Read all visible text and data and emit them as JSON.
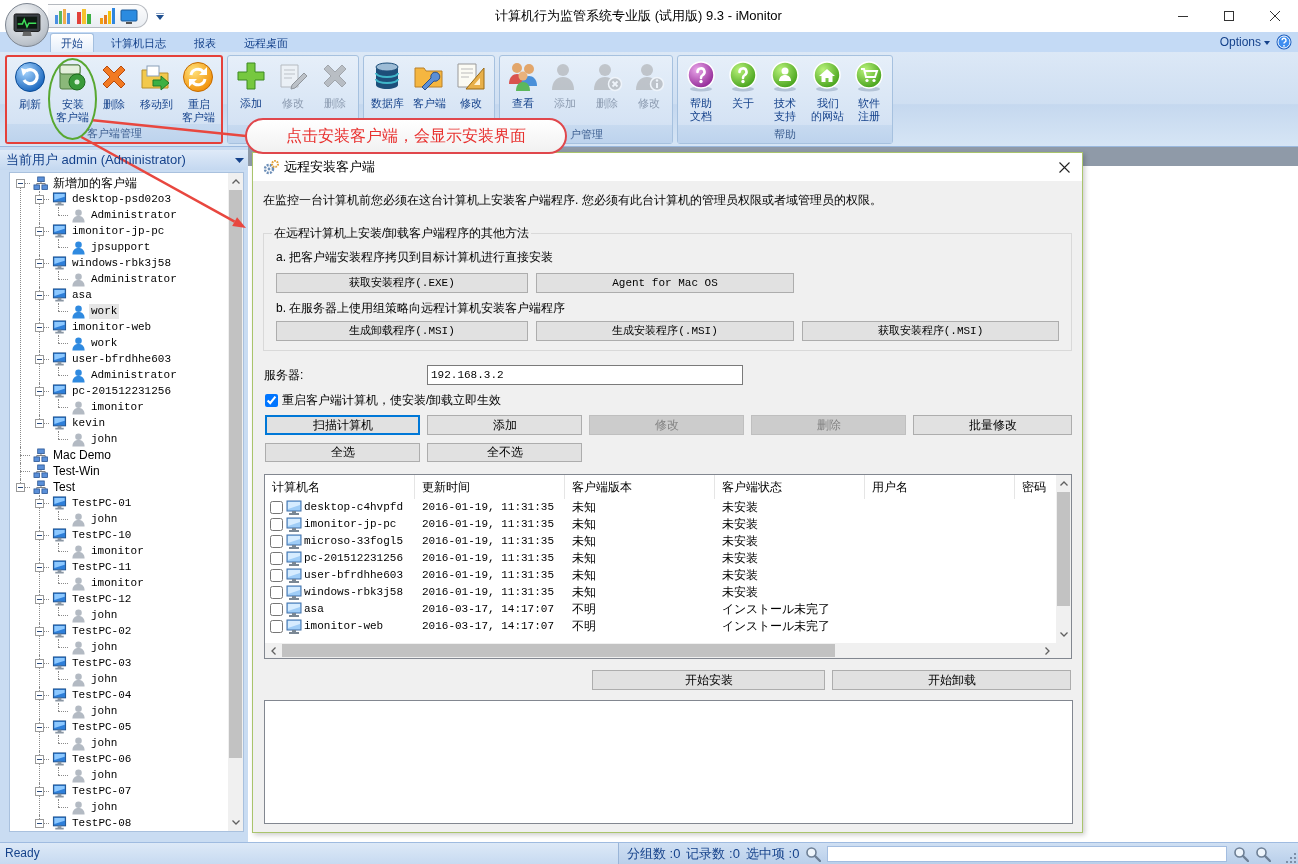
{
  "window": {
    "title": "计算机行为监管系统专业版 (试用版) 9.3 - iMonitor"
  },
  "ribbon": {
    "tabs": [
      {
        "label": "开始",
        "selected": true
      },
      {
        "label": "计算机日志",
        "selected": false
      },
      {
        "label": "报表",
        "selected": false
      },
      {
        "label": "远程桌面",
        "selected": false
      }
    ],
    "options": "Options",
    "groups": [
      {
        "label": "客户端管理",
        "highlighted": true,
        "buttons": [
          {
            "label": "刷新",
            "disabled": false,
            "circled": false
          },
          {
            "label": "安装客户端",
            "disabled": false,
            "circled": true
          },
          {
            "label": "删除",
            "disabled": false,
            "circled": false
          },
          {
            "label": "移动到",
            "disabled": false,
            "circled": false
          },
          {
            "label": "重启客户端",
            "disabled": false,
            "circled": false
          }
        ]
      },
      {
        "highlighted": false,
        "buttons": [
          {
            "label": "添加",
            "disabled": false,
            "circled": false
          },
          {
            "label": "修改",
            "disabled": true,
            "circled": false
          },
          {
            "label": "删除",
            "disabled": true,
            "circled": false
          }
        ]
      },
      {
        "highlighted": false,
        "buttons": [
          {
            "label": "数据库",
            "disabled": false,
            "circled": false
          },
          {
            "label": "客户端",
            "disabled": false,
            "circled": false
          },
          {
            "label": "修改",
            "disabled": false,
            "circled": false
          }
        ]
      },
      {
        "label": "户管理",
        "highlighted": false,
        "buttons": [
          {
            "label": "查看",
            "disabled": false,
            "circled": false
          },
          {
            "label": "添加",
            "disabled": true,
            "circled": false
          },
          {
            "label": "删除",
            "disabled": true,
            "circled": false
          },
          {
            "label": "修改",
            "disabled": true,
            "circled": false
          }
        ]
      },
      {
        "label": "帮助",
        "highlighted": false,
        "buttons": [
          {
            "label": "帮助文档",
            "disabled": false,
            "circled": false
          },
          {
            "label": "关于",
            "disabled": false,
            "circled": false
          },
          {
            "label": "技术支持",
            "disabled": false,
            "circled": false
          },
          {
            "label": "我们的网站",
            "disabled": false,
            "circled": false
          },
          {
            "label": "软件注册",
            "disabled": false,
            "circled": false
          }
        ]
      }
    ]
  },
  "callout": {
    "text": "点击安装客户端，会显示安装界面"
  },
  "sidebar": {
    "header": "当前用户 admin (Administrator)",
    "tree": [
      {
        "label": "新增加的客户端",
        "kind": "group",
        "expanded": true,
        "selected": false,
        "children": [
          {
            "label": "desktop-psd02o3",
            "kind": "computer",
            "expanded": true,
            "selected": false,
            "children": [
              {
                "label": "Administrator",
                "kind": "user",
                "online": false,
                "selected": false
              }
            ]
          },
          {
            "label": "imonitor-jp-pc",
            "kind": "computer",
            "expanded": true,
            "selected": false,
            "children": [
              {
                "label": "jpsupport",
                "kind": "user",
                "online": true,
                "selected": false
              }
            ]
          },
          {
            "label": "windows-rbk3j58",
            "kind": "computer",
            "expanded": true,
            "selected": false,
            "children": [
              {
                "label": "Administrator",
                "kind": "user",
                "online": false,
                "selected": false
              }
            ]
          },
          {
            "label": "asa",
            "kind": "computer",
            "expanded": true,
            "selected": false,
            "children": [
              {
                "label": "work",
                "kind": "user",
                "online": true,
                "selected": true
              }
            ]
          },
          {
            "label": "imonitor-web",
            "kind": "computer",
            "expanded": true,
            "selected": false,
            "children": [
              {
                "label": "work",
                "kind": "user",
                "online": true,
                "selected": false
              }
            ]
          },
          {
            "label": "user-bfrdhhe603",
            "kind": "computer",
            "expanded": true,
            "selected": false,
            "children": [
              {
                "label": "Administrator",
                "kind": "user",
                "online": true,
                "selected": false
              }
            ]
          },
          {
            "label": "pc-201512231256",
            "kind": "computer",
            "expanded": true,
            "selected": false,
            "children": [
              {
                "label": "imonitor",
                "kind": "user",
                "online": false,
                "selected": false
              }
            ]
          },
          {
            "label": "kevin",
            "kind": "computer",
            "expanded": true,
            "selected": false,
            "children": [
              {
                "label": "john",
                "kind": "user",
                "online": false,
                "selected": false
              }
            ]
          }
        ]
      },
      {
        "label": "Mac Demo",
        "kind": "group",
        "selected": false
      },
      {
        "label": "Test-Win",
        "kind": "group",
        "selected": false
      },
      {
        "label": "Test",
        "kind": "group",
        "expanded": true,
        "selected": false,
        "children": [
          {
            "label": "TestPC-01",
            "kind": "computer",
            "expanded": true,
            "selected": false,
            "children": [
              {
                "label": "john",
                "kind": "user",
                "online": false,
                "selected": false
              }
            ]
          },
          {
            "label": "TestPC-10",
            "kind": "computer",
            "expanded": true,
            "selected": false,
            "children": [
              {
                "label": "imonitor",
                "kind": "user",
                "online": false,
                "selected": false
              }
            ]
          },
          {
            "label": "TestPC-11",
            "kind": "computer",
            "expanded": true,
            "selected": false,
            "children": [
              {
                "label": "imonitor",
                "kind": "user",
                "online": false,
                "selected": false
              }
            ]
          },
          {
            "label": "TestPC-12",
            "kind": "computer",
            "expanded": true,
            "selected": false,
            "children": [
              {
                "label": "john",
                "kind": "user",
                "online": false,
                "selected": false
              }
            ]
          },
          {
            "label": "TestPC-02",
            "kind": "computer",
            "expanded": true,
            "selected": false,
            "children": [
              {
                "label": "john",
                "kind": "user",
                "online": false,
                "selected": false
              }
            ]
          },
          {
            "label": "TestPC-03",
            "kind": "computer",
            "expanded": true,
            "selected": false,
            "children": [
              {
                "label": "john",
                "kind": "user",
                "online": false,
                "selected": false
              }
            ]
          },
          {
            "label": "TestPC-04",
            "kind": "computer",
            "expanded": true,
            "selected": false,
            "children": [
              {
                "label": "john",
                "kind": "user",
                "online": false,
                "selected": false
              }
            ]
          },
          {
            "label": "TestPC-05",
            "kind": "computer",
            "expanded": true,
            "selected": false,
            "children": [
              {
                "label": "john",
                "kind": "user",
                "online": false,
                "selected": false
              }
            ]
          },
          {
            "label": "TestPC-06",
            "kind": "computer",
            "expanded": true,
            "selected": false,
            "children": [
              {
                "label": "john",
                "kind": "user",
                "online": false,
                "selected": false
              }
            ]
          },
          {
            "label": "TestPC-07",
            "kind": "computer",
            "expanded": true,
            "selected": false,
            "children": [
              {
                "label": "john",
                "kind": "user",
                "online": false,
                "selected": false
              }
            ]
          },
          {
            "label": "TestPC-08",
            "kind": "computer",
            "expanded": true,
            "selected": false
          }
        ]
      }
    ]
  },
  "dialog": {
    "title": "远程安装客户端",
    "intro": "在监控一台计算机前您必须在这台计算机上安装客户端程序. 您必须有此台计算机的管理员权限或者域管理员的权限。",
    "other_methods": {
      "legend": "在远程计算机上安装/卸载客户端程序的其他方法",
      "sections": [
        {
          "text": "a. 把客户端安装程序拷贝到目标计算机进行直接安装",
          "buttons": [
            "获取安装程序(.EXE)",
            "Agent for Mac OS"
          ]
        },
        {
          "text": "b. 在服务器上使用组策略向远程计算机安装客户端程序",
          "buttons": [
            "生成卸载程序(.MSI)",
            "生成安装程序(.MSI)",
            "获取安装程序(.MSI)"
          ]
        }
      ]
    },
    "server": {
      "label": "服务器:",
      "value": "192.168.3.2"
    },
    "restart_option": {
      "label": "重启客户端计算机，使安装/卸载立即生效",
      "checked": true
    },
    "actions": [
      {
        "label": "扫描计算机",
        "disabled": false,
        "focused": true
      },
      {
        "label": "添加",
        "disabled": false,
        "focused": false
      },
      {
        "label": "修改",
        "disabled": true,
        "focused": false
      },
      {
        "label": "删除",
        "disabled": true,
        "focused": false
      },
      {
        "label": "批量修改",
        "disabled": false,
        "focused": false
      }
    ],
    "selection_buttons": [
      "全选",
      "全不选"
    ],
    "table": {
      "columns": [
        "计算机名",
        "更新时间",
        "客户端版本",
        "客户端状态",
        "用户名",
        "密码"
      ],
      "rows": [
        {
          "checked": false,
          "cells": [
            "desktop-c4hvpfd",
            "2016-01-19, 11:31:35",
            "未知",
            "未安装"
          ]
        },
        {
          "checked": false,
          "cells": [
            "imonitor-jp-pc",
            "2016-01-19, 11:31:35",
            "未知",
            "未安装"
          ]
        },
        {
          "checked": false,
          "cells": [
            "microso-33fogl5",
            "2016-01-19, 11:31:35",
            "未知",
            "未安装"
          ]
        },
        {
          "checked": false,
          "cells": [
            "pc-201512231256",
            "2016-01-19, 11:31:35",
            "未知",
            "未安装"
          ]
        },
        {
          "checked": false,
          "cells": [
            "user-bfrdhhe603",
            "2016-01-19, 11:31:35",
            "未知",
            "未安装"
          ]
        },
        {
          "checked": false,
          "cells": [
            "windows-rbk3j58",
            "2016-01-19, 11:31:35",
            "未知",
            "未安装"
          ]
        },
        {
          "checked": false,
          "cells": [
            "asa",
            "2016-03-17, 14:17:07",
            "不明",
            "インストール未完了"
          ]
        },
        {
          "checked": false,
          "cells": [
            "imonitor-web",
            "2016-03-17, 14:17:07",
            "不明",
            "インストール未完了"
          ]
        }
      ]
    },
    "install_buttons": [
      "开始安装",
      "开始卸载"
    ]
  },
  "status_bar": {
    "text": "Ready",
    "counts": [
      "分组数 :0",
      "记录数 :0",
      "选中项 :0"
    ]
  }
}
